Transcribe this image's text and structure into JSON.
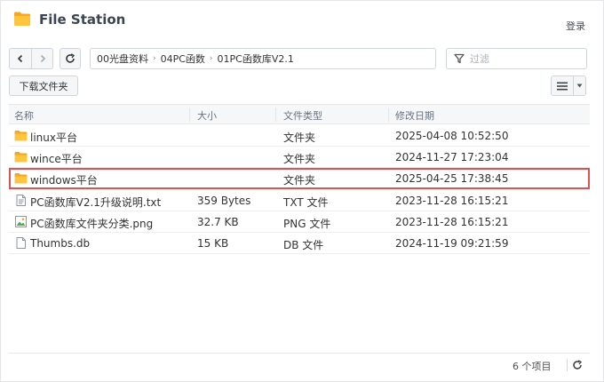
{
  "window": {
    "title": "File Station",
    "login_label": "登录",
    "accent_color": "#f5a623"
  },
  "toolbar": {
    "back_icon": "chevron-left-icon",
    "forward_icon": "chevron-right-icon",
    "refresh_icon": "refresh-icon",
    "breadcrumbs": [
      "00光盘资料",
      "04PC函数",
      "01PC函数库V2.1"
    ],
    "filter_placeholder": "过滤",
    "filter_value": "",
    "download_label": "下载文件夹",
    "view_icon": "list-view-icon"
  },
  "list": {
    "columns": {
      "name": "名称",
      "size": "大小",
      "type": "文件类型",
      "modified": "修改日期"
    },
    "rows": [
      {
        "name": "linux平台",
        "size": "",
        "type": "文件夹",
        "modified": "2025-04-08 10:52:50",
        "icon": "folder-icon",
        "selected": false
      },
      {
        "name": "wince平台",
        "size": "",
        "type": "文件夹",
        "modified": "2024-11-27 17:23:04",
        "icon": "folder-icon",
        "selected": false
      },
      {
        "name": "windows平台",
        "size": "",
        "type": "文件夹",
        "modified": "2025-04-25 17:38:45",
        "icon": "folder-icon",
        "selected": true
      },
      {
        "name": "PC函数库V2.1升级说明.txt",
        "size": "359 Bytes",
        "type": "TXT 文件",
        "modified": "2023-11-28 16:15:21",
        "icon": "text-file-icon",
        "selected": false
      },
      {
        "name": "PC函数库文件夹分类.png",
        "size": "32.7 KB",
        "type": "PNG 文件",
        "modified": "2023-11-28 16:15:21",
        "icon": "image-file-icon",
        "selected": false
      },
      {
        "name": "Thumbs.db",
        "size": "15 KB",
        "type": "DB 文件",
        "modified": "2024-11-19 09:21:59",
        "icon": "blank-file-icon",
        "selected": false
      }
    ],
    "selection_color": "#e05252"
  },
  "status": {
    "item_count": "6 个项目",
    "refresh_icon": "refresh-icon"
  }
}
